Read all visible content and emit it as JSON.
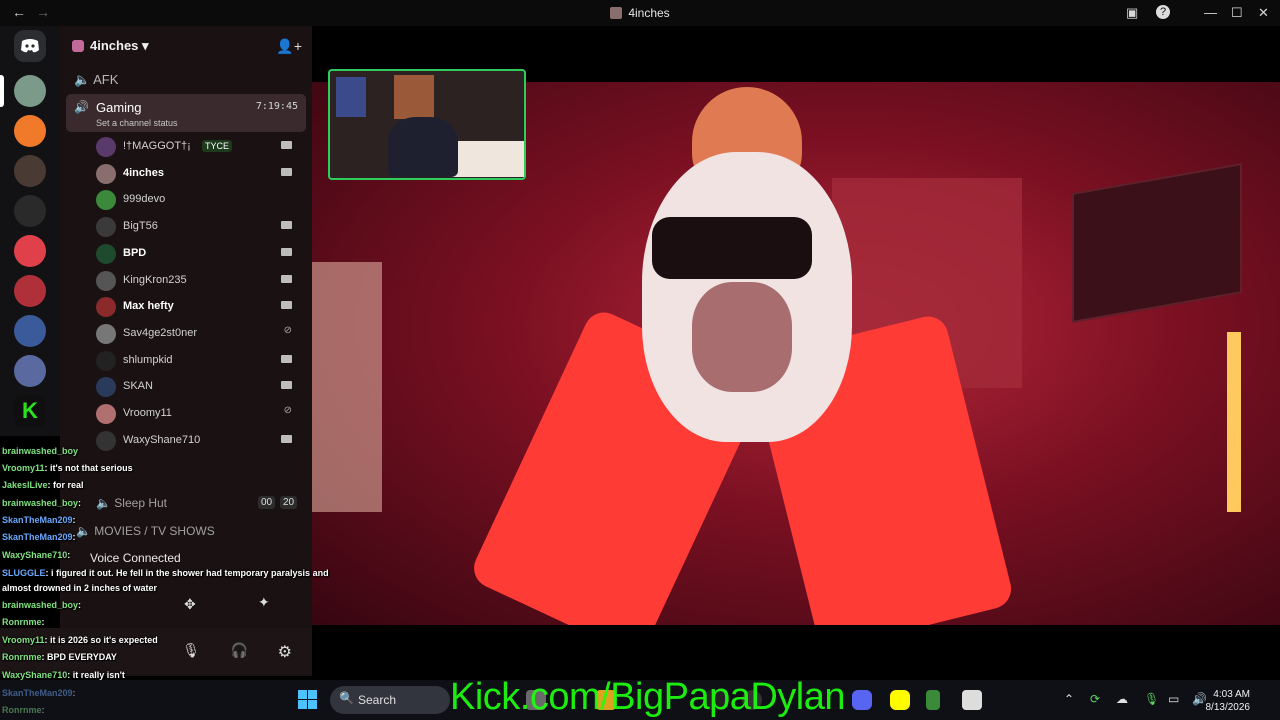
{
  "window": {
    "title": "4inches",
    "nav_back": "←",
    "nav_forward": "→",
    "inbox": "▣",
    "help": "?",
    "minimize": "—",
    "maximize": "☐",
    "close": "✕"
  },
  "server": {
    "name": "4inches"
  },
  "channels": {
    "afk": "AFK",
    "active": {
      "name": "Gaming",
      "timer": "7:19:45",
      "status": "Set a channel status"
    },
    "sleep_hut": "Sleep Hut",
    "sleep_hut_count_a": "00",
    "sleep_hut_count_b": "20",
    "movies": "MOVIES / TV SHOWS",
    "voice_status": "Voice Connected"
  },
  "members": [
    {
      "name": "!†MAGGOT†¡",
      "tag": "TYCE",
      "cam": "on",
      "bold": false,
      "color": "#5a3a6a"
    },
    {
      "name": "4inches",
      "cam": "on",
      "bold": true,
      "color": "#8a6e6e"
    },
    {
      "name": "999devo",
      "cam": "none",
      "bold": false,
      "color": "#3b8a3b"
    },
    {
      "name": "BigT56",
      "cam": "on",
      "bold": false,
      "color": "#3a3a3a"
    },
    {
      "name": "BPD",
      "cam": "on",
      "bold": true,
      "color": "#1e4a2e"
    },
    {
      "name": "KingKron235",
      "cam": "on",
      "bold": false,
      "color": "#555555"
    },
    {
      "name": "Max hefty",
      "cam": "on",
      "bold": true,
      "color": "#8a2a2a"
    },
    {
      "name": "Sav4ge2st0ner",
      "cam": "off",
      "bold": false,
      "color": "#777777"
    },
    {
      "name": "shlumpkid",
      "cam": "on",
      "bold": false,
      "color": "#222222"
    },
    {
      "name": "SKAN",
      "cam": "on",
      "bold": false,
      "color": "#2a3a5a"
    },
    {
      "name": "Vroomy11",
      "cam": "off",
      "bold": false,
      "color": "#b07070"
    },
    {
      "name": "WaxyShane710",
      "cam": "on",
      "bold": false,
      "color": "#333333"
    }
  ],
  "chat": [
    {
      "user": "brainwashed_boy",
      "text": "",
      "color": "green"
    },
    {
      "user": "Vroomy11",
      "text": ": it's not that serious",
      "color": "green"
    },
    {
      "user": "JakeslLive",
      "text": ": for real",
      "color": "green"
    },
    {
      "user": "brainwashed_boy",
      "text": ":",
      "color": "green"
    },
    {
      "user": "SkanTheMan209",
      "text": ":",
      "color": "blue"
    },
    {
      "user": "SkanTheMan209",
      "text": ":",
      "color": "blue"
    },
    {
      "user": "WaxyShane710",
      "text": ":",
      "color": "green"
    },
    {
      "user": "SLUGGLE",
      "text": ": i figured it out. He fell in the shower had temporary paralysis and",
      "color": "blue"
    },
    {
      "user": "",
      "text": "almost drowned in 2 inches of water",
      "color": "white"
    },
    {
      "user": "brainwashed_boy",
      "text": ":",
      "color": "green"
    },
    {
      "user": "Ronrnme",
      "text": ":",
      "color": "green"
    },
    {
      "user": "Vroomy11",
      "text": ": it is 2026 so it's expected",
      "color": "green"
    },
    {
      "user": "Ronrnme",
      "text": ": BPD EVERYDAY",
      "color": "green"
    },
    {
      "user": "WaxyShane710",
      "text": ": it really isn't",
      "color": "green"
    },
    {
      "user": "SkanTheMan209",
      "text": ":",
      "color": "blue"
    },
    {
      "user": "Ronrnme",
      "text": ":",
      "color": "green"
    }
  ],
  "overlay": {
    "kick_text": "Kick.com/BigPapaDylan"
  },
  "taskbar": {
    "search_label": "Search",
    "time": "4:03 AM",
    "date": "8/13/2026"
  }
}
